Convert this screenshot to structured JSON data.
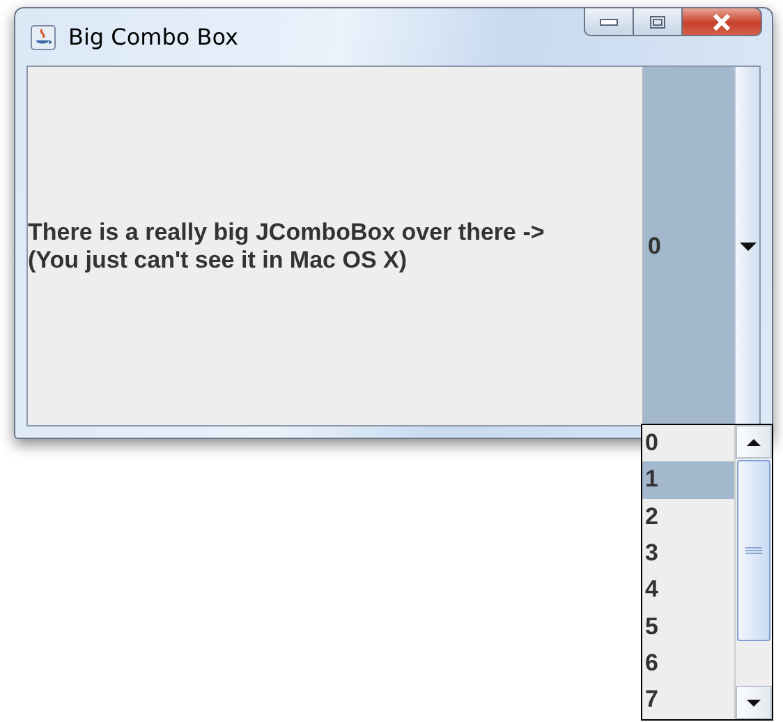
{
  "window": {
    "title": "Big Combo Box"
  },
  "message": [
    "There is a really big JComboBox over there ->",
    "(You just can't see it in Mac OS X)"
  ],
  "combo": {
    "value": "0"
  },
  "popup": {
    "items": [
      {
        "label": "0",
        "selected": false
      },
      {
        "label": "1",
        "selected": true
      },
      {
        "label": "2",
        "selected": false
      },
      {
        "label": "3",
        "selected": false
      },
      {
        "label": "4",
        "selected": false
      },
      {
        "label": "5",
        "selected": false
      },
      {
        "label": "6",
        "selected": false
      },
      {
        "label": "7",
        "selected": false
      }
    ]
  }
}
